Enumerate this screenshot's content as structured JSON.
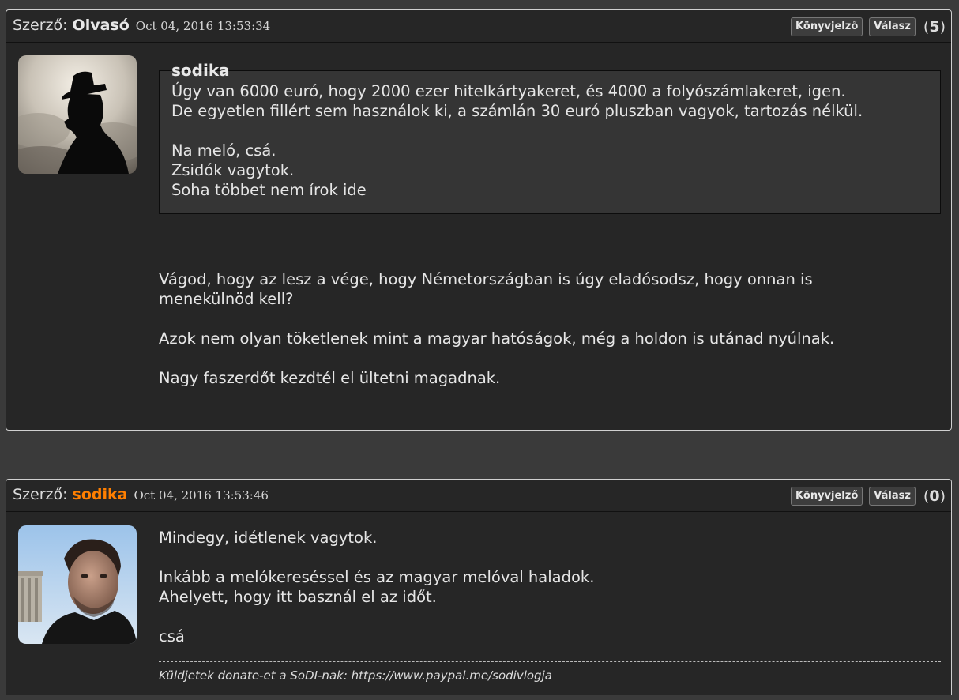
{
  "posts": [
    {
      "by_label": "Szerző:",
      "author": "Olvasó",
      "date": "Oct 04, 2016 13:53:34",
      "bookmark_label": "Könyvjelző",
      "reply_label": "Válasz",
      "score_open": "(",
      "score": "5",
      "score_close": ")",
      "quote": {
        "author": "sodika",
        "lines": [
          "Úgy van 6000 euró, hogy 2000 ezer hitelkártyakeret, és 4000 a folyószámlakeret, igen.",
          "De egyetlen fillért sem használok ki, a számlán 30 euró pluszban vagyok, tartozás nélkül.",
          "",
          "Na meló, csá.",
          "Zsidók vagytok.",
          "Soha többet nem írok ide"
        ]
      },
      "body_lines": [
        "Vágod, hogy az lesz a vége, hogy Németországban is úgy eladósodsz, hogy onnan is",
        "menekülnöd kell?",
        "",
        "Azok nem olyan töketlenek mint a magyar hatóságok, még a holdon is utánad nyúlnak.",
        "",
        "Nagy faszerdőt kezdtél el ültetni magadnak."
      ]
    },
    {
      "by_label": "Szerző:",
      "author": "sodika",
      "date": "Oct 04, 2016 13:53:46",
      "bookmark_label": "Könyvjelző",
      "reply_label": "Válasz",
      "score_open": "(",
      "score": "0",
      "score_close": ")",
      "body_lines": [
        "Mindegy, idétlenek vagytok.",
        "",
        "Inkább a melókereséssel és az magyar melóval haladok.",
        "Ahelyett, hogy itt basznál el az időt.",
        "",
        "csá"
      ],
      "signature": "Küldjetek donate-et a SoDI-nak: https://www.paypal.me/sodivlogja"
    }
  ],
  "colors": {
    "page_bg": "#3a3a3a",
    "post_bg": "#262626",
    "quote_bg": "#353535",
    "author_highlight": "#ff7f00"
  }
}
